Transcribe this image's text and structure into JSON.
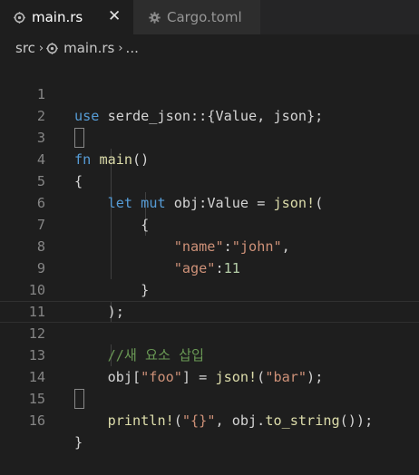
{
  "tabs": [
    {
      "label": "main.rs",
      "icon": "rust-icon",
      "active": true,
      "close": "✕"
    },
    {
      "label": "Cargo.toml",
      "icon": "gear-icon",
      "active": false
    }
  ],
  "breadcrumb": {
    "folder": "src",
    "file": "main.rs",
    "symbol": "...",
    "separator": "›"
  },
  "code": {
    "line_numbers": [
      "1",
      "2",
      "3",
      "4",
      "5",
      "6",
      "7",
      "8",
      "9",
      "10",
      "11",
      "12",
      "13",
      "14",
      "15",
      "16"
    ],
    "l1_use": "use",
    "l1_rest": " serde_json::{Value, json};",
    "l3_fn": "fn",
    "l3_main": "main",
    "l3_rest": "()",
    "l4_brace": "{",
    "l5_indent": "    ",
    "l5_let": "let",
    "l5_mut": "mut",
    "l5_rest": " obj:Value = ",
    "l5_macro": "json!",
    "l5_paren": "(",
    "l6": "        {",
    "l7_indent": "            ",
    "l7_key": "\"name\"",
    "l7_colon": ":",
    "l7_val": "\"john\"",
    "l7_comma": ",",
    "l8_indent": "            ",
    "l8_key": "\"age\"",
    "l8_colon": ":",
    "l8_val": "11",
    "l9": "        }",
    "l10": "    );",
    "l12_indent": "    ",
    "l12_comment": "//새 요소 삽입",
    "l13_indent": "    ",
    "l13_obj": "obj[",
    "l13_key": "\"foo\"",
    "l13_mid": "] = ",
    "l13_macro": "json!",
    "l13_open": "(",
    "l13_val": "\"bar\"",
    "l13_end": ");",
    "l15_indent": "    ",
    "l15_macro": "println!",
    "l15_open": "(",
    "l15_fmt": "\"{}\"",
    "l15_mid": ", obj.",
    "l15_method": "to_string",
    "l15_end": "());",
    "l16_brace": "}"
  },
  "colors": {
    "background": "#1e1e1e",
    "keyword": "#569cd6",
    "function": "#dcdcaa",
    "string": "#ce9178",
    "number": "#b5cea8",
    "comment": "#6a9955",
    "line_number": "#858585"
  }
}
